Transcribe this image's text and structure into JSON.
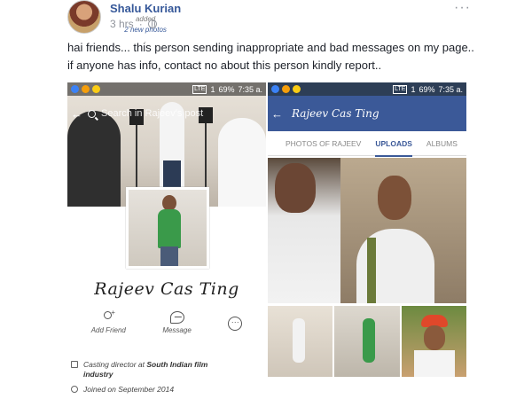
{
  "post": {
    "author": "Shalu Kurian",
    "action_prefix": "added",
    "action_link": "2 new photos",
    "action_suffix": ".",
    "time": "3 hrs",
    "time_sep": "·",
    "more": "···",
    "text": "hai friends... this person sending inappropriate and bad messages on my page.. if anyone has info, contact no about this person kindly report.."
  },
  "left_screen": {
    "status": {
      "lte": "LTE",
      "signal": "1",
      "battery": "69%",
      "time": "7:35 a."
    },
    "back": "←",
    "search_placeholder": "Search in Rajeev's post",
    "profile_name": "Rajeev Cas Ting",
    "actions": [
      {
        "label": "Add Friend",
        "icon": "add-friend-icon"
      },
      {
        "label": "Message",
        "icon": "messenger-icon"
      },
      {
        "label": "",
        "icon": "more-circle-icon",
        "glyph": "···"
      }
    ],
    "info": [
      {
        "prefix": "Casting director at ",
        "bold": "South Indian film",
        "suffix": "industry",
        "icon": "briefcase-icon"
      },
      {
        "prefix": "Joined on September 2014",
        "bold": "",
        "suffix": "",
        "icon": "clock-icon"
      }
    ]
  },
  "right_screen": {
    "status": {
      "lte": "LTE",
      "signal": "1",
      "battery": "69%",
      "time": "7:35 a."
    },
    "back": "←",
    "title": "Rajeev Cas Ting",
    "tabs": [
      {
        "label": "PHOTOS OF RAJEEV",
        "active": false
      },
      {
        "label": "UPLOADS",
        "active": true
      },
      {
        "label": "ALBUMS",
        "active": false
      }
    ]
  },
  "colors": {
    "fb_blue": "#3b5998",
    "link": "#365899",
    "meta_gray": "#90949c"
  }
}
